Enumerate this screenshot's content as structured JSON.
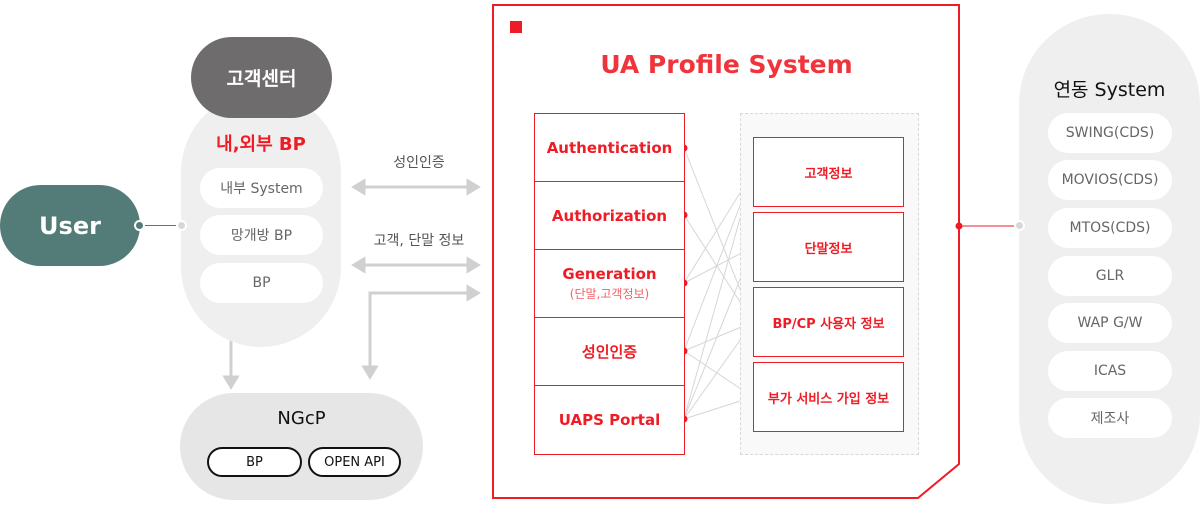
{
  "user": {
    "label": "User"
  },
  "bp_group": {
    "header": "고객센터",
    "title": "내,외부 BP",
    "items": [
      "내부 System",
      "망개방 BP",
      "BP"
    ]
  },
  "ngcp": {
    "title": "NGcP",
    "buttons": [
      "BP",
      "OPEN API"
    ]
  },
  "arrows": {
    "adult_auth": "성인인증",
    "customer_device_info": "고객, 단말 정보"
  },
  "ua_profile": {
    "title": "UA Profile System",
    "functions": [
      {
        "label": "Authentication",
        "sub": ""
      },
      {
        "label": "Authorization",
        "sub": ""
      },
      {
        "label": "Generation",
        "sub": "(단말,고객정보)"
      },
      {
        "label": "성인인증",
        "sub": ""
      },
      {
        "label": "UAPS Portal",
        "sub": ""
      }
    ],
    "data_stores": [
      "고객정보",
      "단말정보",
      "BP/CP 사용자 정보",
      "부가 서비스 가입 정보"
    ],
    "connections": [
      [
        0,
        2
      ],
      [
        1,
        2
      ],
      [
        2,
        0
      ],
      [
        2,
        1
      ],
      [
        3,
        0
      ],
      [
        3,
        2
      ],
      [
        3,
        3
      ],
      [
        4,
        0
      ],
      [
        4,
        1
      ],
      [
        4,
        2
      ],
      [
        4,
        3
      ]
    ]
  },
  "linked_systems": {
    "title": "연동 System",
    "items": [
      "SWING(CDS)",
      "MOVIOS(CDS)",
      "MTOS(CDS)",
      "GLR",
      "WAP G/W",
      "ICAS",
      "제조사"
    ]
  },
  "colors": {
    "accent_red": "#ee1c25",
    "user_teal": "#537b78",
    "header_gray": "#6e6c6d"
  }
}
